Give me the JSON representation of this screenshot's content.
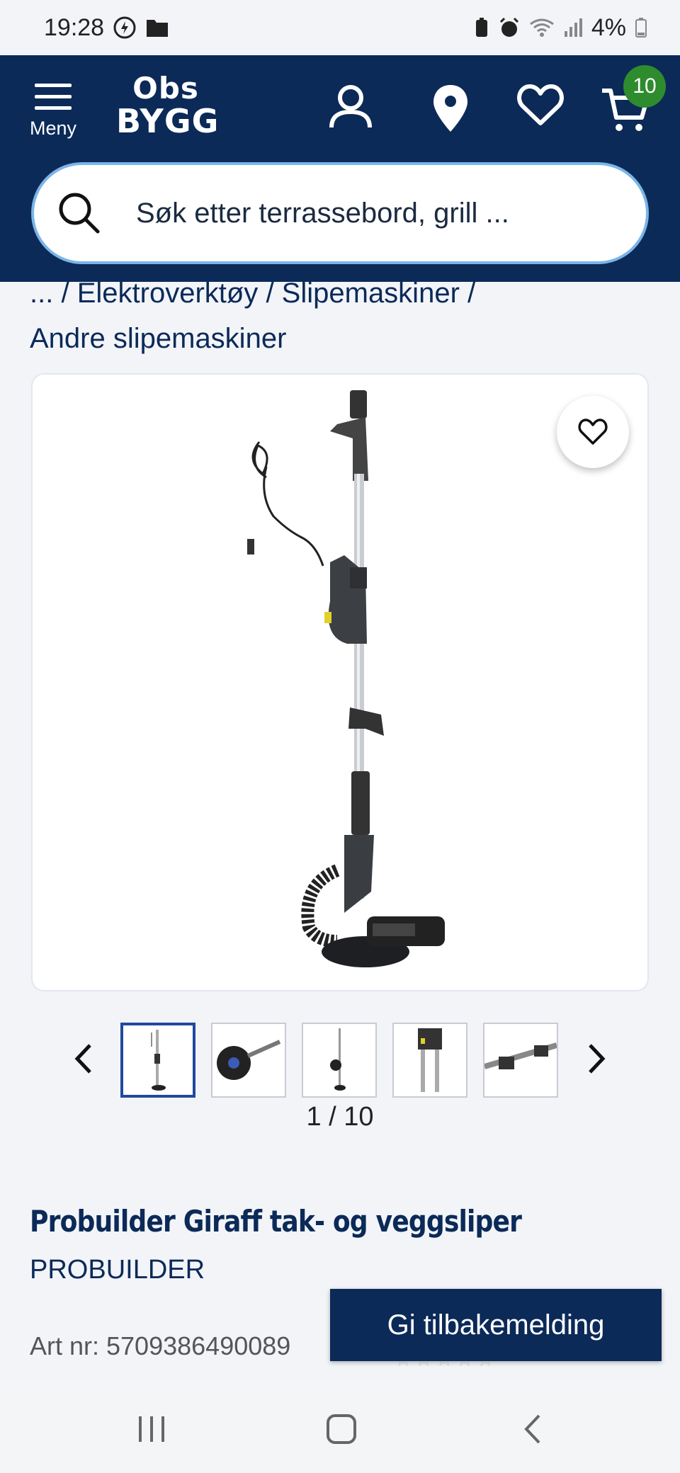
{
  "status": {
    "time": "19:28",
    "battery": "4%"
  },
  "header": {
    "menu_label": "Meny",
    "logo_line1": "Obs",
    "logo_line2": "BYGG",
    "cart_count": "10",
    "search_placeholder": "Søk etter terrassebord, grill ..."
  },
  "breadcrumb": {
    "ellipsis": "...",
    "items": [
      "Elektroverktøy",
      "Slipemaskiner",
      "Andre slipemaskiner"
    ]
  },
  "gallery": {
    "counter": "1 / 10",
    "thumb_count": 5,
    "active_index": 0
  },
  "product": {
    "title": "Probuilder Giraff tak- og veggsliper",
    "brand": "PROBUILDER",
    "art_nr": "Art nr: 5709386490089",
    "rating_stars": "☆☆☆☆☆"
  },
  "feedback_label": "Gi tilbakemelding",
  "colors": {
    "brand_navy": "#0b2a58",
    "cart_badge": "#2e8b2e",
    "search_border": "#7bb4e8"
  }
}
